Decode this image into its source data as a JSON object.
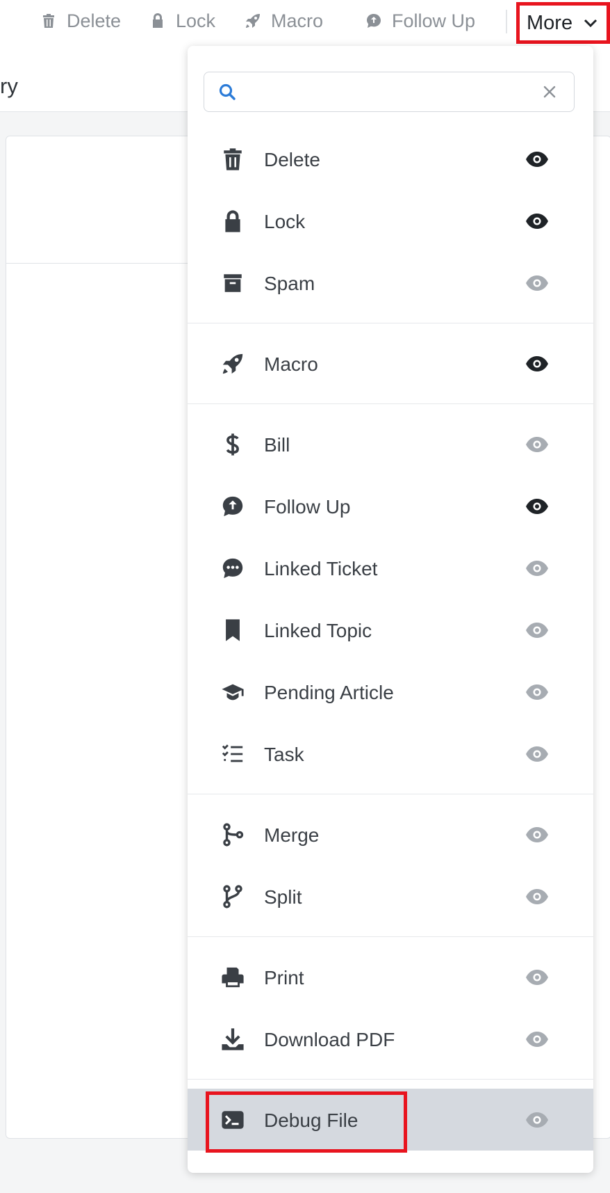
{
  "toolbar": {
    "delete_label": "Delete",
    "lock_label": "Lock",
    "macro_label": "Macro",
    "follow_up_label": "Follow Up",
    "more_label": "More"
  },
  "background": {
    "title_fragment": "ry"
  },
  "search": {
    "value": "",
    "placeholder": ""
  },
  "menu": {
    "groups": [
      [
        {
          "label": "Delete",
          "icon": "trash-icon",
          "visible": true
        },
        {
          "label": "Lock",
          "icon": "lock-icon",
          "visible": true
        },
        {
          "label": "Spam",
          "icon": "archive-icon",
          "visible": false
        }
      ],
      [
        {
          "label": "Macro",
          "icon": "rocket-icon",
          "visible": true
        }
      ],
      [
        {
          "label": "Bill",
          "icon": "dollar-icon",
          "visible": false
        },
        {
          "label": "Follow Up",
          "icon": "follow-up-icon",
          "visible": true
        },
        {
          "label": "Linked Ticket",
          "icon": "comment-dots-icon",
          "visible": false
        },
        {
          "label": "Linked Topic",
          "icon": "bookmark-icon",
          "visible": false
        },
        {
          "label": "Pending Article",
          "icon": "graduation-cap-icon",
          "visible": false
        },
        {
          "label": "Task",
          "icon": "task-list-icon",
          "visible": false
        }
      ],
      [
        {
          "label": "Merge",
          "icon": "merge-icon",
          "visible": false
        },
        {
          "label": "Split",
          "icon": "split-icon",
          "visible": false
        }
      ],
      [
        {
          "label": "Print",
          "icon": "print-icon",
          "visible": false
        },
        {
          "label": "Download PDF",
          "icon": "download-icon",
          "visible": false
        }
      ],
      [
        {
          "label": "Debug File",
          "icon": "terminal-icon",
          "visible": false,
          "active": true
        }
      ]
    ]
  },
  "colors": {
    "highlight": "#e8141e",
    "eye_on": "#1f2327",
    "eye_off": "#a7acb2",
    "active_bg": "#d5d9df",
    "search_icon": "#2b7bd8"
  }
}
